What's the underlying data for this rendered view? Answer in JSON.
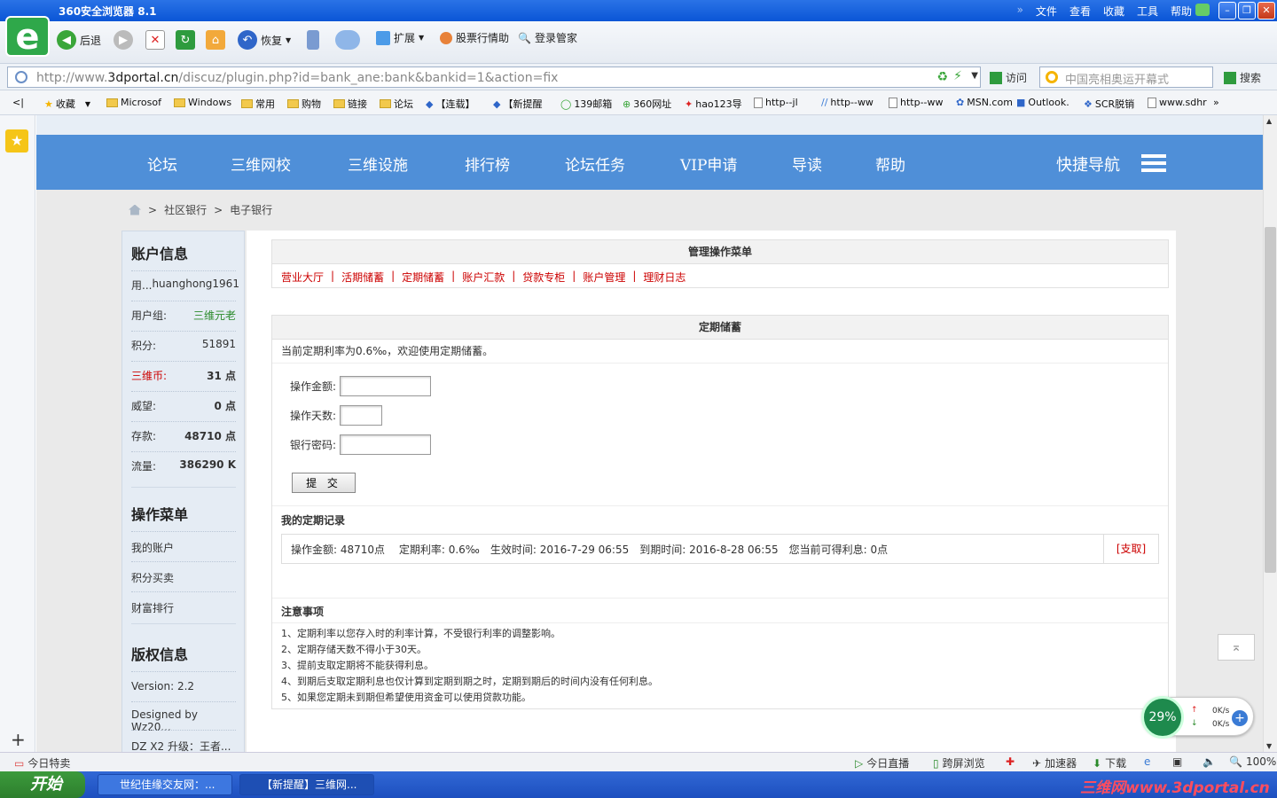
{
  "browser": {
    "title": "360安全浏览器 8.1",
    "menus": [
      "文件",
      "查看",
      "收藏",
      "工具",
      "帮助"
    ],
    "toolbar": {
      "back": "后退",
      "restore": "恢复",
      "extend": "扩展",
      "stock": "股票行情助",
      "login": "登录管家"
    },
    "url_prefix": "http://www.",
    "url_domain": "3dportal.cn",
    "url_rest": "/discuz/plugin.php?id=bank_ane:bank&bankid=1&action=fix",
    "visit": "访问",
    "search_placeholder": "中国亮相奥运开幕式",
    "search": "搜索",
    "bookmarks": [
      "收藏",
      "Microsof",
      "Windows",
      "常用",
      "购物",
      "链接",
      "论坛",
      "【连载】",
      "【新提醒",
      "139邮箱",
      "360网址",
      "hao123导",
      "http--jl",
      "http--ww",
      "http--ww",
      "MSN.com",
      "Outlook.",
      "SCR脱销",
      "www.sdhr"
    ]
  },
  "site": {
    "nav": [
      "论坛",
      "三维网校",
      "三维设施",
      "排行榜",
      "论坛任务",
      "VIP申请",
      "导读",
      "帮助"
    ],
    "quicknav": "快捷导航",
    "breadcrumb": [
      "社区银行",
      "电子银行"
    ],
    "breadcrumb_sep": ">"
  },
  "account": {
    "title": "账户信息",
    "username_label": "用...",
    "username": "huanghong1961",
    "group_label": "用户组:",
    "group": "三维元老",
    "points_label": "积分:",
    "points": "51891",
    "coins_label": "三维币:",
    "coins": "31 点",
    "prestige_label": "威望:",
    "prestige": "0 点",
    "deposit_label": "存款:",
    "deposit": "48710 点",
    "traffic_label": "流量:",
    "traffic": "386290 K"
  },
  "opmenu": {
    "title": "操作菜单",
    "items": [
      "我的账户",
      "积分买卖",
      "财富排行"
    ]
  },
  "copyright": {
    "title": "版权信息",
    "version": "Version: 2.2",
    "designed": "Designed by Wz20...",
    "dz": "DZ X2 升级：王者..."
  },
  "manage": {
    "title": "管理操作菜单",
    "links": [
      "营业大厅",
      "活期储蓄",
      "定期储蓄",
      "账户汇款",
      "贷款专柜",
      "账户管理",
      "理财日志"
    ],
    "sep": "|"
  },
  "fixed": {
    "title": "定期储蓄",
    "rate_text": "当前定期利率为0.6‰，欢迎使用定期储蓄。",
    "amount_label": "操作金额:",
    "days_label": "操作天数:",
    "password_label": "银行密码:",
    "amount_value": "",
    "days_value": "",
    "password_value": "",
    "submit": "提 交",
    "records_title": "我的定期记录",
    "record": "操作金额: 48710点　 定期利率: 0.6‰　生效时间: 2016-7-29 06:55　到期时间: 2016-8-28 06:55　您当前可得利息: 0点",
    "withdraw": "[支取]",
    "notes_title": "注意事项",
    "notes": [
      "1、定期利率以您存入时的利率计算，不受银行利率的调整影响。",
      "2、定期存储天数不得小于30天。",
      "3、提前支取定期将不能获得利息。",
      "4、到期后支取定期利息也仅计算到定期到期之时，定期到期后的时间内没有任何利息。",
      "5、如果您定期未到期但希望使用资金可以使用贷款功能。"
    ]
  },
  "speed": {
    "percent": "29%",
    "up": "0K/s",
    "down": "0K/s"
  },
  "status": {
    "today": "今日特卖",
    "live": "今日直播",
    "cross": "跨屏浏览",
    "accel": "加速器",
    "download": "下载",
    "zoom": "100%"
  },
  "taskbar": {
    "start": "开始",
    "tasks": [
      "世纪佳缘交友网：...",
      "【新提醒】三维网..."
    ],
    "watermark": "三维网www.3dportal.cn"
  }
}
